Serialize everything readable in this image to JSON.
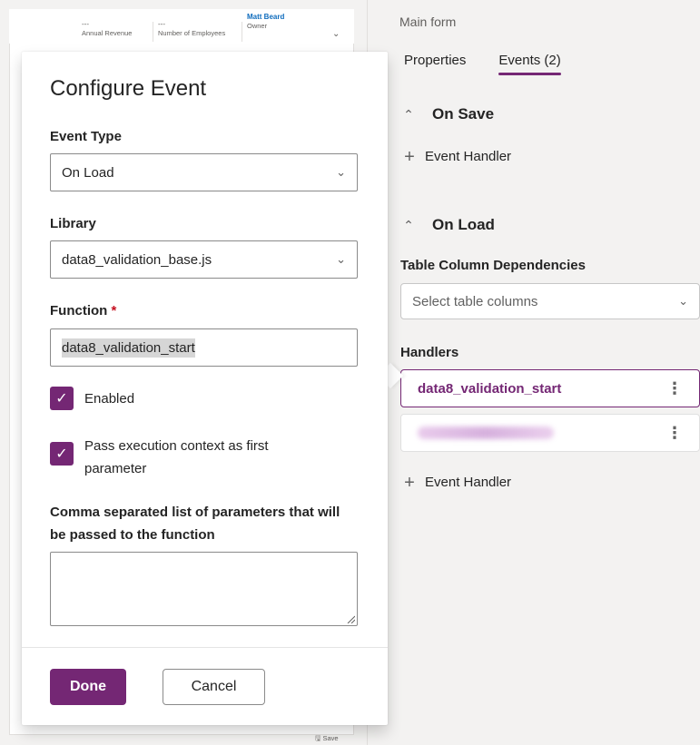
{
  "background_form": {
    "annual_revenue_value": "---",
    "annual_revenue_label": "Annual Revenue",
    "employees_value": "---",
    "employees_label": "Number of Employees",
    "owner_value": "Matt Beard",
    "owner_label": "Owner",
    "save_label": "Save"
  },
  "properties_pane": {
    "form_type": "Main form",
    "tabs": [
      {
        "label": "Properties",
        "active": false
      },
      {
        "label": "Events (2)",
        "active": true
      }
    ],
    "on_save": {
      "heading": "On Save",
      "add_handler_label": "Event Handler"
    },
    "on_load": {
      "heading": "On Load",
      "dependencies_label": "Table Column Dependencies",
      "dependencies_placeholder": "Select table columns",
      "handlers_label": "Handlers",
      "handlers": [
        {
          "name": "data8_validation_start",
          "selected": true
        },
        {
          "name": "",
          "selected": false,
          "redacted": true
        }
      ],
      "add_handler_label": "Event Handler"
    }
  },
  "dialog": {
    "title": "Configure Event",
    "event_type_label": "Event Type",
    "event_type_value": "On Load",
    "library_label": "Library",
    "library_value": "data8_validation_base.js",
    "function_label": "Function",
    "function_required_marker": "*",
    "function_value": "data8_validation_start",
    "enabled_label": "Enabled",
    "enabled_checked": true,
    "pass_context_label": "Pass execution context as first parameter",
    "pass_context_checked": true,
    "parameters_label": "Comma separated list of parameters that will be passed to the function",
    "parameters_value": "",
    "done_label": "Done",
    "cancel_label": "Cancel"
  },
  "colors": {
    "accent": "#742774",
    "required": "#c50f1f",
    "link": "#0f6cbd"
  }
}
